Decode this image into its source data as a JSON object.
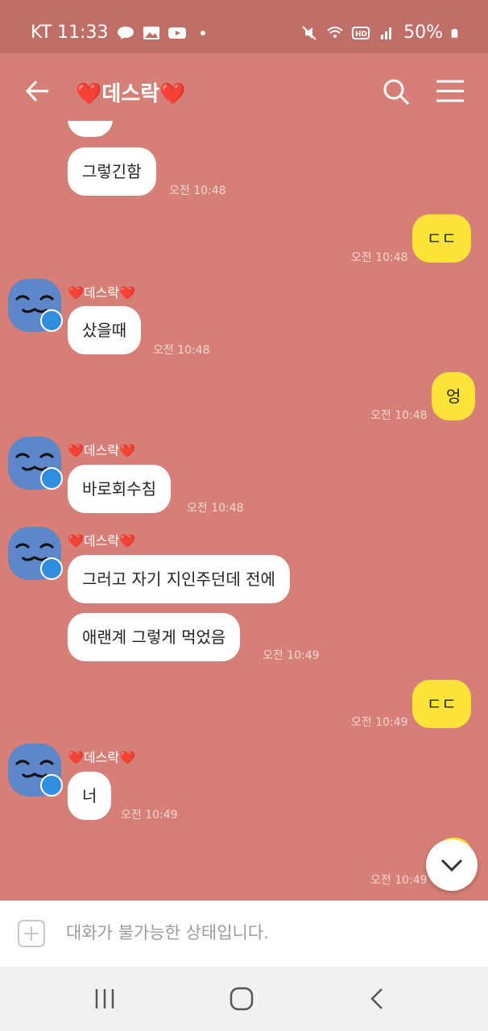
{
  "status_bar": {
    "carrier_time": "KT 11:33",
    "battery": "50%",
    "left_icons": [
      "talk-icon",
      "image-icon",
      "youtube-icon",
      "dot-icon"
    ],
    "right_icons": [
      "mute-icon",
      "wifi-icon",
      "hd-icon",
      "signal-icon",
      "battery-icon"
    ]
  },
  "header": {
    "title": "❤️데스락❤️"
  },
  "messages": [
    {
      "id": "m1",
      "side": "left",
      "text": "그렇긴함",
      "time": "오전 10:48"
    },
    {
      "id": "m2",
      "side": "right",
      "text": "ㄷㄷ",
      "time": "오전 10:48"
    },
    {
      "id": "m3",
      "side": "left",
      "sender": "❤️데스락❤️",
      "text": "샀을때",
      "time": "오전 10:48"
    },
    {
      "id": "m4",
      "side": "right",
      "text": "엉",
      "time": "오전 10:48"
    },
    {
      "id": "m5",
      "side": "left",
      "sender": "❤️데스락❤️",
      "text": "바로회수침",
      "time": "오전 10:48"
    },
    {
      "id": "m6",
      "side": "left",
      "sender": "❤️데스락❤️",
      "text": "그러고 자기 지인주던데 전에"
    },
    {
      "id": "m7",
      "side": "left",
      "text": "애랜계 그렇게 먹었음",
      "time": "오전 10:49"
    },
    {
      "id": "m8",
      "side": "right",
      "text": "ㄷㄷ",
      "time": "오전 10:49"
    },
    {
      "id": "m9",
      "side": "left",
      "sender": "❤️데스락❤️",
      "text": "너",
      "time": "오전 10:49"
    },
    {
      "id": "m10",
      "side": "right",
      "text": "?",
      "time": "오전 10:49"
    }
  ],
  "input": {
    "placeholder": "대화가 불가능한 상태입니다."
  },
  "colors": {
    "chat_background": "#d67f76",
    "status_bar": "#bf6f68",
    "my_bubble": "#fde43a",
    "other_bubble": "#ffffff"
  }
}
